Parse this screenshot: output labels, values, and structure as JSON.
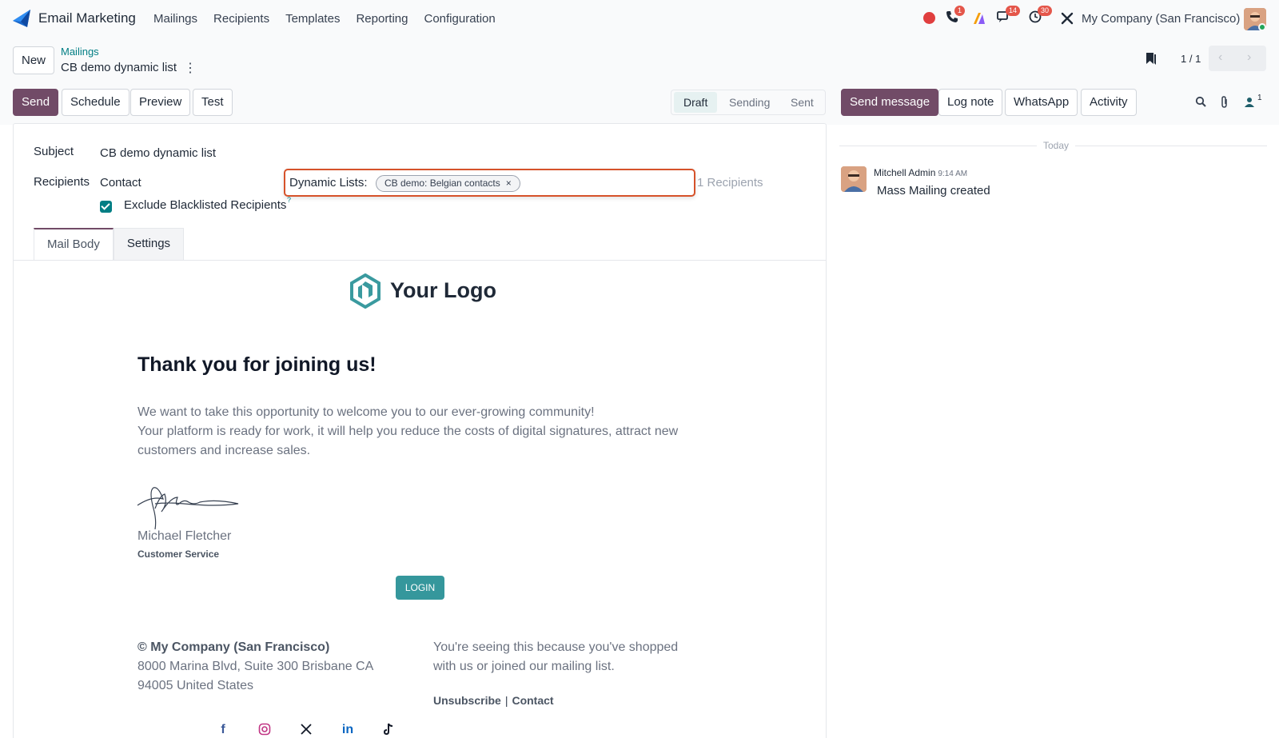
{
  "navbar": {
    "app_name": "Email Marketing",
    "menu": [
      "Mailings",
      "Recipients",
      "Templates",
      "Reporting",
      "Configuration"
    ],
    "badges": {
      "phone": "1",
      "messages": "14",
      "activities": "30"
    },
    "company": "My Company (San Francisco)"
  },
  "control": {
    "new_label": "New",
    "breadcrumb": "Mailings",
    "record_title": "CB demo dynamic list",
    "pager": "1 / 1"
  },
  "actions": {
    "send": "Send",
    "schedule": "Schedule",
    "preview": "Preview",
    "test": "Test"
  },
  "status": {
    "stages": [
      "Draft",
      "Sending",
      "Sent"
    ],
    "active": "Draft"
  },
  "chatter_buttons": {
    "send_message": "Send message",
    "log_note": "Log note",
    "whatsapp": "WhatsApp",
    "activity": "Activity",
    "followers_count": "1"
  },
  "form": {
    "subject_label": "Subject",
    "subject_value": "CB demo dynamic list",
    "recipients_label": "Recipients",
    "recipients_model": "Contact",
    "dynamic_lists_label": "Dynamic Lists:",
    "dynamic_list_tag": "CB demo: Belgian contacts",
    "recipients_count": "1 Recipients",
    "exclude_blacklisted_label": "Exclude Blacklisted Recipients",
    "exclude_blacklisted_checked": true,
    "help_mark": "?",
    "tabs": [
      "Mail Body",
      "Settings"
    ],
    "active_tab": "Mail Body"
  },
  "mail": {
    "logo_text": "Your Logo",
    "heading": "Thank you for joining us!",
    "para1": "We want to take this opportunity to welcome you to our ever-growing community!",
    "para2": "Your platform is ready for work, it will help you reduce the costs of digital signatures, attract new customers and increase sales.",
    "signer_name": "Michael Fletcher",
    "signer_role": "Customer Service",
    "cta": "LOGIN",
    "footer_company": "© My Company (San Francisco)",
    "footer_address1": "8000 Marina Blvd, Suite 300 Brisbane CA",
    "footer_address2": "94005 United States",
    "footer_notice": "You're seeing this because you've shopped with us or joined our mailing list.",
    "unsubscribe": "Unsubscribe",
    "link_separator": "|",
    "contact": "Contact",
    "social_icons": [
      "facebook-icon",
      "instagram-icon",
      "x-icon",
      "linkedin-icon",
      "tiktok-icon"
    ]
  },
  "chatter": {
    "date_separator": "Today",
    "message": {
      "author": "Mitchell Admin",
      "time": "9:14 AM",
      "body": "Mass Mailing created"
    }
  },
  "colors": {
    "primary": "#714b67",
    "accent": "#017e84",
    "focus_border": "#d6522a",
    "cta": "#35979c",
    "badge": "#e4564a"
  }
}
